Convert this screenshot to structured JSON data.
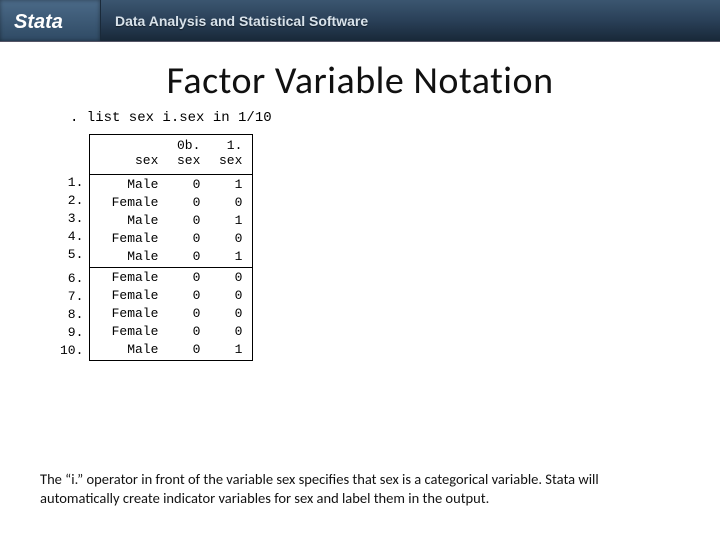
{
  "header": {
    "brand": "Stata",
    "tagline": "Data Analysis and Statistical Software"
  },
  "title": "Factor Variable Notation",
  "command": ". list sex i.sex in 1/10",
  "table": {
    "col_headers": {
      "c1_line1": "",
      "c1_line2": "sex",
      "c2_line1": "0b.",
      "c2_line2": "sex",
      "c3_line1": "1.",
      "c3_line2": "sex"
    },
    "groups": [
      [
        {
          "n": "1.",
          "sex": "Male",
          "g0": "0",
          "g1": "1"
        },
        {
          "n": "2.",
          "sex": "Female",
          "g0": "0",
          "g1": "0"
        },
        {
          "n": "3.",
          "sex": "Male",
          "g0": "0",
          "g1": "1"
        },
        {
          "n": "4.",
          "sex": "Female",
          "g0": "0",
          "g1": "0"
        },
        {
          "n": "5.",
          "sex": "Male",
          "g0": "0",
          "g1": "1"
        }
      ],
      [
        {
          "n": "6.",
          "sex": "Female",
          "g0": "0",
          "g1": "0"
        },
        {
          "n": "7.",
          "sex": "Female",
          "g0": "0",
          "g1": "0"
        },
        {
          "n": "8.",
          "sex": "Female",
          "g0": "0",
          "g1": "0"
        },
        {
          "n": "9.",
          "sex": "Female",
          "g0": "0",
          "g1": "0"
        },
        {
          "n": "10.",
          "sex": "Male",
          "g0": "0",
          "g1": "1"
        }
      ]
    ]
  },
  "caption": "The “i.” operator in front of the variable sex specifies that sex is a categorical variable. Stata will automatically create indicator variables for sex and label them in the output."
}
